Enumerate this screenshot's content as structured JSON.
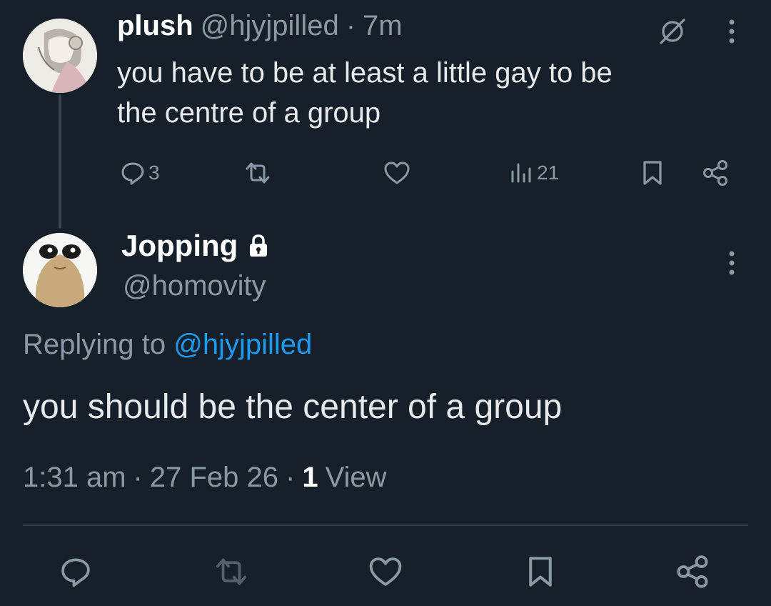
{
  "parent_tweet": {
    "display_name": "plush",
    "handle": "@hjyjpilled",
    "separator": "·",
    "time_ago": "7m",
    "text_line1": "you have to be at least a little gay to be",
    "text_line2": "the centre of a group",
    "reply_count": "3",
    "views_count": "21",
    "avatar_icon": "anime-character-avatar"
  },
  "reply_tweet": {
    "display_name": "Jopping",
    "handle": "@homovity",
    "replying_prefix": "Replying to",
    "replying_handle": "@hjyjpilled",
    "text": "you should be the center of a group",
    "timestamp": "1:31 am",
    "sep1": "·",
    "date": "27 Feb 26",
    "sep2": "·",
    "view_count": "1",
    "view_label": "View",
    "avatar_icon": "pou-creature-avatar"
  },
  "colors": {
    "background": "#15202b",
    "text": "#e7e9ea",
    "muted": "#8b98a5",
    "link": "#1d9bf0",
    "divider": "#38444d"
  }
}
